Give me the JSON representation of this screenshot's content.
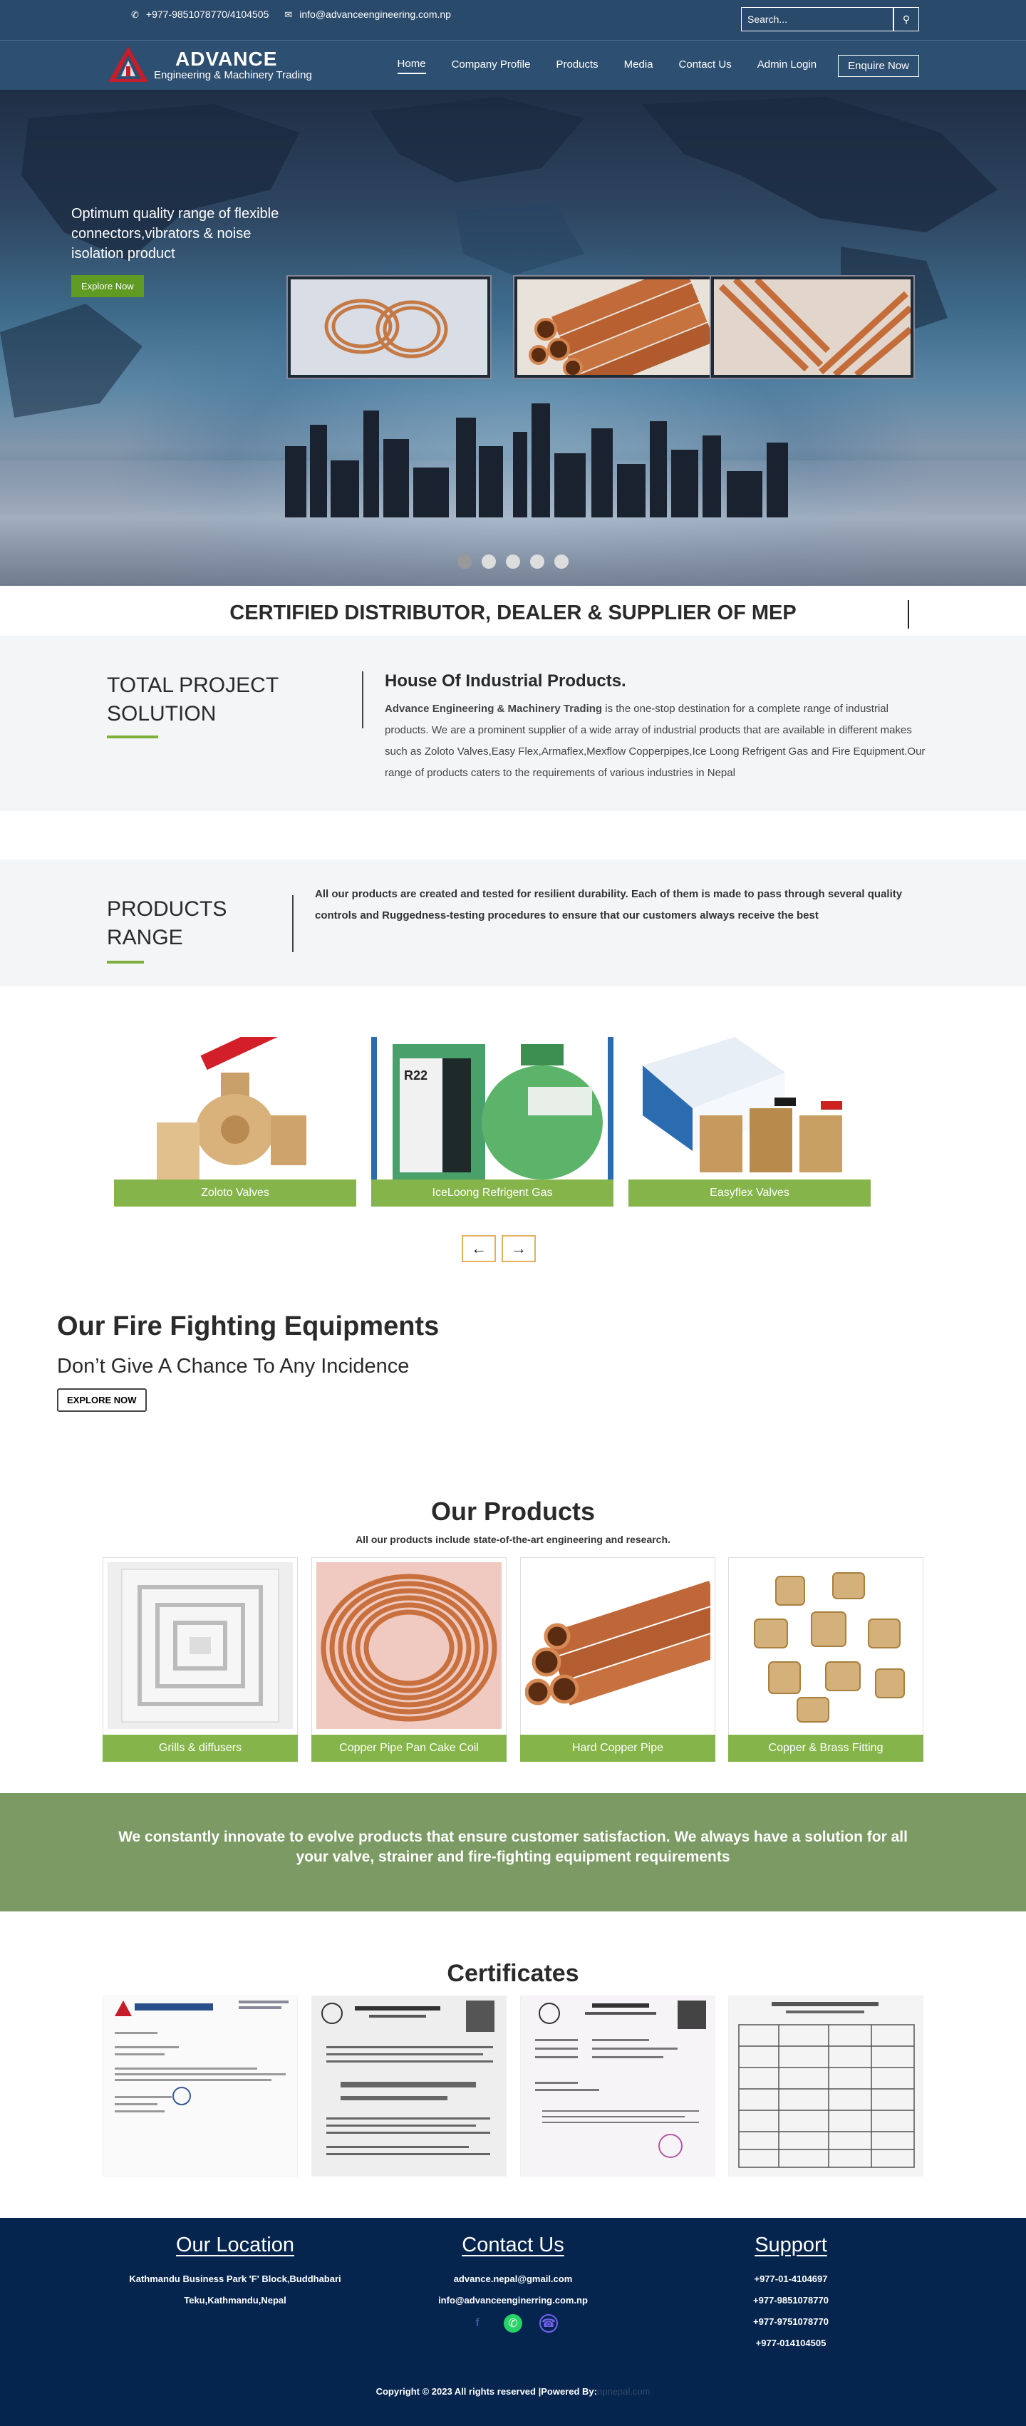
{
  "topbar": {
    "phone": "+977-9851078770/4104505",
    "email": "info@advanceengineering.com.np",
    "search_placeholder": "Search..."
  },
  "logo": {
    "brand": "ADVANCE",
    "subtitle": "Engineering & Machinery Trading"
  },
  "nav": {
    "items": [
      "Home",
      "Company Profile",
      "Products",
      "Media",
      "Contact Us",
      "Admin Login"
    ],
    "active": "Home",
    "enquire": "Enquire Now"
  },
  "hero": {
    "headline": "Optimum quality range of flexible connectors,vibrators & noise isolation product",
    "button": "Explore Now",
    "slides": 5,
    "active_slide": 1
  },
  "tagline": "CERTIFIED DISTRIBUTOR, DEALER & SUPPLIER OF MEP",
  "total_project": {
    "title": "TOTAL PROJECT SOLUTION",
    "heading": "House Of Industrial Products.",
    "company": "Advance Engineering & Machinery Trading",
    "body": " is the one-stop destination for a complete range of industrial products. We are a prominent supplier of a wide array of industrial products that are available in different makes such as Zoloto Valves,Easy Flex,Armaflex,Mexflow Copperpipes,Ice Loong Refrigent Gas and Fire Equipment.Our range of products caters to the requirements of various industries in Nepal"
  },
  "products_range": {
    "title": "PRODUCTS RANGE",
    "body": "All our products are created and tested for resilient durability. Each of them is made to pass through several quality controls and Ruggedness-testing procedures to ensure that our customers always receive the best"
  },
  "slider_products": [
    {
      "label": "Zoloto Valves",
      "icon": "brass-ball-valve"
    },
    {
      "label": "IceLoong Refrigent Gas",
      "icon": "refrigerant-cylinder"
    },
    {
      "label": "Easyflex Valves",
      "icon": "brass-valves"
    }
  ],
  "slider_arrows": {
    "prev": "←",
    "next": "→"
  },
  "fire": {
    "title": "Our Fire Fighting Equipments",
    "subtitle": "Don’t Give A Chance To Any Incidence",
    "button": "EXPLORE NOW"
  },
  "our_products": {
    "title": "Our Products",
    "subtitle": "All our products include state-of-the-art engineering and research.",
    "items": [
      {
        "label": "Grills & diffusers",
        "icon": "ceiling-diffuser"
      },
      {
        "label": "Copper Pipe Pan Cake Coil",
        "icon": "copper-coil"
      },
      {
        "label": "Hard Copper Pipe",
        "icon": "copper-pipes"
      },
      {
        "label": "Copper & Brass Fitting",
        "icon": "brass-fittings"
      }
    ]
  },
  "banner": "We constantly innovate to evolve products that ensure customer satisfaction. We always have a solution for all your valve, strainer and fire-fighting equipment requirements",
  "certificates": {
    "title": "Certificates",
    "items": [
      "certificate-letterhead",
      "certificate-registration",
      "certificate-tax",
      "certificate-table"
    ]
  },
  "footer": {
    "location_title": "Our Location",
    "address_line1": "Kathmandu Business Park 'F' Block,Buddhabari",
    "address_line2": "Teku,Kathmandu,Nepal",
    "contact_title": "Contact Us",
    "contact_email1": "advance.nepal@gmail.com",
    "contact_email2": "info@advanceenginerring.com.np",
    "support_title": "Support",
    "phones": [
      "+977-01-4104697",
      "+977-9851078770",
      "+977-9751078770",
      "+977-014104505"
    ],
    "social_icons": [
      "facebook-icon",
      "whatsapp-icon",
      "viber-icon"
    ],
    "copyright": "Copyright © 2023 All rights reserved |Powered By:",
    "powered": "npnepal.com"
  },
  "colors": {
    "topbar": "#2a4a6b",
    "navbar": "#2d4f71",
    "accent_green": "#85b54a",
    "banner_green": "#7c9b64",
    "footer": "#05254f"
  }
}
